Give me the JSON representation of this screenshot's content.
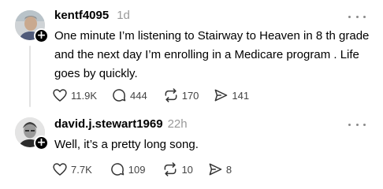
{
  "posts": [
    {
      "username": "kentf4095",
      "time": "1d",
      "text": "One minute I’m listening to Stairway to Heaven in 8 th grade and the next day I’m enrolling in a Medicare program . Life goes by quickly.",
      "likes": "11.9K",
      "replies": "444",
      "reposts": "170",
      "shares": "141",
      "avatar_icon": "profile-photo",
      "badge_symbol": "+"
    },
    {
      "username": "david.j.stewart1969",
      "time": "22h",
      "text": "Well, it’s a pretty long song.",
      "likes": "7.7K",
      "replies": "109",
      "reposts": "10",
      "shares": "8",
      "avatar_icon": "profile-photo",
      "badge_symbol": "+"
    }
  ],
  "icons": {
    "like": "heart-icon",
    "reply": "comment-icon",
    "repost": "repost-icon",
    "share": "send-icon",
    "more": "more-horizontal-icon"
  },
  "colors": {
    "text": "#000000",
    "muted": "#999999",
    "count": "#444444",
    "thread_line": "#e2e2e2"
  }
}
